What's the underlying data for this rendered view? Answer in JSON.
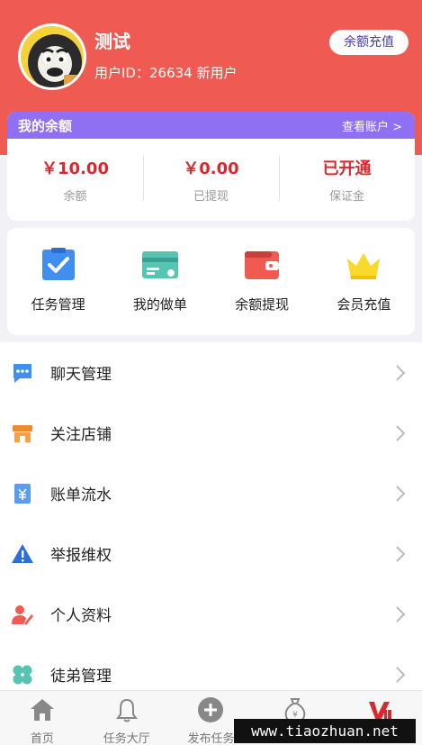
{
  "profile": {
    "name": "测试",
    "user_id_label": "用户ID：",
    "user_id": "26634",
    "user_status": "新用户",
    "recharge_button": "余额充值"
  },
  "balance": {
    "title": "我的余额",
    "link": "查看账户 >",
    "stats": [
      {
        "value": "￥10.00",
        "label": "余额"
      },
      {
        "value": "￥0.00",
        "label": "已提现"
      },
      {
        "value": "已开通",
        "label": "保证金"
      }
    ]
  },
  "quick": [
    {
      "label": "任务管理",
      "icon": "clipboard-check-icon"
    },
    {
      "label": "我的做单",
      "icon": "card-icon"
    },
    {
      "label": "余额提现",
      "icon": "wallet-icon"
    },
    {
      "label": "会员充值",
      "icon": "crown-icon"
    }
  ],
  "menu": [
    {
      "label": "聊天管理",
      "icon": "chat-icon"
    },
    {
      "label": "关注店铺",
      "icon": "shop-icon"
    },
    {
      "label": "账单流水",
      "icon": "bill-icon"
    },
    {
      "label": "举报维权",
      "icon": "warning-icon"
    },
    {
      "label": "个人资料",
      "icon": "profile-edit-icon"
    },
    {
      "label": "徒弟管理",
      "icon": "clover-icon"
    }
  ],
  "tabbar": [
    {
      "label": "首页",
      "icon": "home-icon"
    },
    {
      "label": "任务大厅",
      "icon": "bell-icon"
    },
    {
      "label": "发布任务",
      "icon": "plus-circle-icon"
    },
    {
      "label": "",
      "icon": "money-bag-icon"
    },
    {
      "label": "",
      "icon": "vip-icon"
    }
  ],
  "watermark": "www.tiaozhuan.net",
  "colors": {
    "header": "#ef5a52",
    "balance_header": "#8f6ff2",
    "amount_red": "#d9292f",
    "recharge_text": "#4a3aa0"
  }
}
